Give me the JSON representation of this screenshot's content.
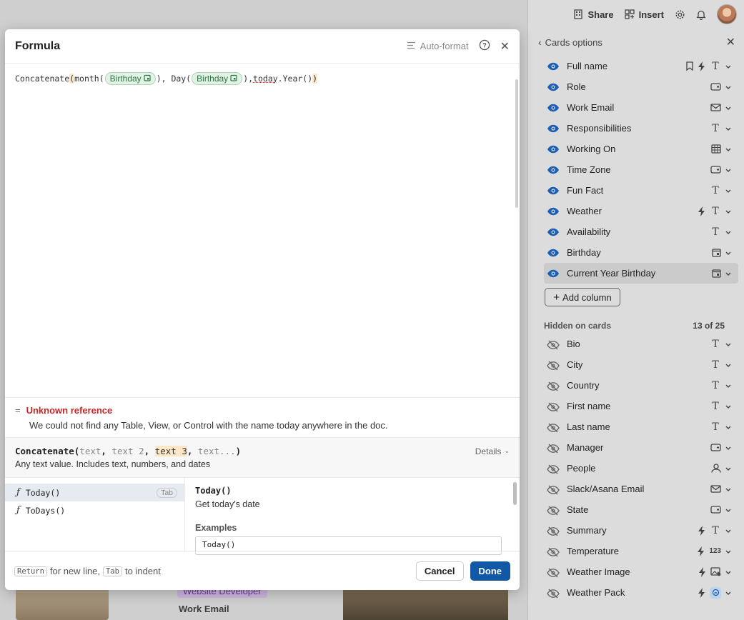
{
  "topbar": {
    "share": "Share",
    "insert": "Insert"
  },
  "panel": {
    "title": "Cards options",
    "visible_columns": [
      {
        "name": "Full name",
        "icons": [
          "bookmark-icon",
          "bolt-icon",
          "text-type-icon"
        ]
      },
      {
        "name": "Role",
        "icons": [
          "select-type-icon"
        ]
      },
      {
        "name": "Work Email",
        "icons": [
          "email-type-icon"
        ]
      },
      {
        "name": "Responsibilities",
        "icons": [
          "text-type-icon"
        ]
      },
      {
        "name": "Working On",
        "icons": [
          "table-type-icon"
        ]
      },
      {
        "name": "Time Zone",
        "icons": [
          "select-type-icon"
        ]
      },
      {
        "name": "Fun Fact",
        "icons": [
          "text-type-icon"
        ]
      },
      {
        "name": "Weather",
        "icons": [
          "bolt-icon",
          "text-type-icon"
        ]
      },
      {
        "name": "Availability",
        "icons": [
          "text-type-icon"
        ]
      },
      {
        "name": "Birthday",
        "icons": [
          "date-type-icon"
        ]
      },
      {
        "name": "Current Year Birthday",
        "icons": [
          "date-type-icon"
        ],
        "selected": true
      }
    ],
    "add_column": "Add column",
    "hidden_title": "Hidden on cards",
    "hidden_count": "13 of 25",
    "hidden_columns": [
      {
        "name": "Bio",
        "icons": [
          "text-type-icon"
        ]
      },
      {
        "name": "City",
        "icons": [
          "text-type-icon"
        ]
      },
      {
        "name": "Country",
        "icons": [
          "text-type-icon"
        ]
      },
      {
        "name": "First name",
        "icons": [
          "text-type-icon"
        ]
      },
      {
        "name": "Last name",
        "icons": [
          "text-type-icon"
        ]
      },
      {
        "name": "Manager",
        "icons": [
          "select-type-icon"
        ]
      },
      {
        "name": "People",
        "icons": [
          "person-type-icon"
        ]
      },
      {
        "name": "Slack/Asana Email",
        "icons": [
          "email-type-icon"
        ]
      },
      {
        "name": "State",
        "icons": [
          "select-type-icon"
        ]
      },
      {
        "name": "Summary",
        "icons": [
          "bolt-icon",
          "text-type-icon"
        ]
      },
      {
        "name": "Temperature",
        "icons": [
          "bolt-icon",
          "number-type-icon"
        ]
      },
      {
        "name": "Weather Image",
        "icons": [
          "bolt-icon",
          "image-type-icon"
        ]
      },
      {
        "name": "Weather Pack",
        "icons": [
          "bolt-icon",
          "pack-type-icon"
        ]
      }
    ]
  },
  "modal": {
    "title": "Formula",
    "auto_format": "Auto-format",
    "formula": {
      "fn": "Concatenate",
      "month_fn": "month(",
      "chip1": "Birthday",
      "mid1": "), Day(",
      "chip2": "Birthday",
      "mid2": "), ",
      "bad_ref": "today",
      "tail": ".Year()"
    },
    "error": {
      "title": "Unknown reference",
      "desc": "We could not find any Table, View, or Control with the name today anywhere in the doc."
    },
    "signature": {
      "fn": "Concatenate(",
      "p1": "text",
      "p2": "text 2",
      "p3": "text 3",
      "p4": "text...",
      "close": ")",
      "details": "Details",
      "desc": "Any text value. Includes text, numbers, and dates"
    },
    "suggestions": [
      {
        "name": "Today()",
        "badge": "Tab"
      },
      {
        "name": "ToDays()",
        "badge": ""
      }
    ],
    "detail": {
      "name": "Today()",
      "desc": "Get today's date",
      "examples_label": "Examples",
      "example": "Today()"
    },
    "footer": {
      "key1": "Return",
      "hint1": "for new line,",
      "key2": "Tab",
      "hint2": "to indent",
      "cancel": "Cancel",
      "done": "Done"
    }
  },
  "background": {
    "tag": "Website Developer",
    "label": "Work Email"
  },
  "colors": {
    "accent": "#1158a6",
    "error": "#c62828",
    "chip_bg": "#e3f2e6",
    "chip_text": "#2a7a3f",
    "eye": "#1a5fb4"
  }
}
